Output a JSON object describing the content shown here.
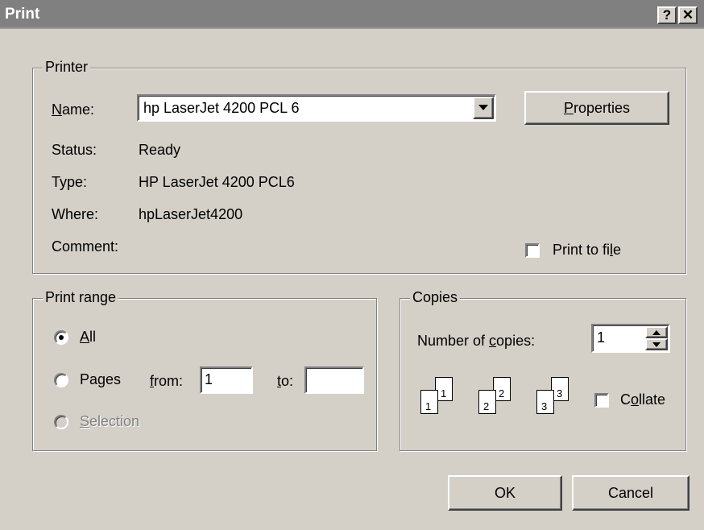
{
  "window": {
    "title": "Print",
    "help_label": "?",
    "close_label": "✕"
  },
  "printer": {
    "legend": "Printer",
    "name_label_u": "N",
    "name_label_rest": "ame:",
    "name_value": "hp LaserJet 4200 PCL 6",
    "properties_label_u": "P",
    "properties_label_rest": "roperties",
    "status_label": "Status:",
    "status_value": "Ready",
    "type_label": "Type:",
    "type_value": "HP LaserJet 4200 PCL6",
    "where_label": "Where:",
    "where_value": "hpLaserJet4200",
    "comment_label": "Comment:",
    "print_to_file_pre": "Print to fi",
    "print_to_file_u": "l",
    "print_to_file_post": "e"
  },
  "print_range": {
    "legend": "Print range",
    "all_u": "A",
    "all_rest": "ll",
    "pages_pre": "Pa",
    "pages_u": "g",
    "pages_post": "es",
    "from_u": "f",
    "from_rest": "rom:",
    "from_value": "1",
    "to_u": "t",
    "to_rest": "o:",
    "to_value": "",
    "selection_u": "S",
    "selection_rest": "election",
    "selected": "All"
  },
  "copies": {
    "legend": "Copies",
    "number_pre": "Number of ",
    "number_u": "c",
    "number_post": "opies:",
    "number_value": "1",
    "collate_pre": "C",
    "collate_u": "o",
    "collate_post": "llate",
    "collate_checked": false,
    "page_numbers": [
      "1",
      "1",
      "2",
      "2",
      "3",
      "3"
    ]
  },
  "buttons": {
    "ok": "OK",
    "cancel": "Cancel"
  },
  "icons": {
    "dropdown": "chevron-down-icon",
    "spin_up": "spin-up-icon",
    "spin_down": "spin-down-icon"
  }
}
